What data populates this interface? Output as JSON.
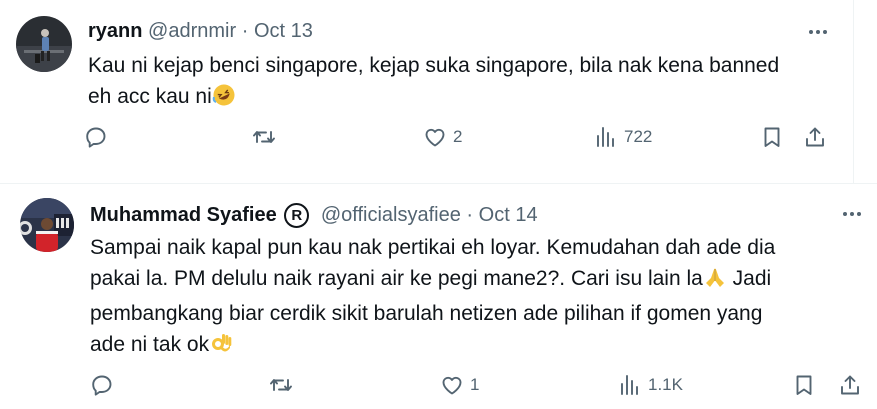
{
  "tweets": [
    {
      "display_name": "ryann",
      "handle": "@adrnmir",
      "separator": "·",
      "date": "Oct 13",
      "text_line1": "Kau ni kejap benci singapore, kejap suka singapore, bila nak kena banned",
      "text_line2": "eh acc kau ni",
      "emoji": "rolling-on-floor-laughing",
      "replies": "",
      "retweets": "",
      "likes": "2",
      "views": "722"
    },
    {
      "display_name": "Muhammad Syafiee",
      "badge": "R",
      "handle": "@officialsyafiee",
      "separator": "·",
      "date": "Oct 14",
      "text_line1": "Sampai naik kapal pun kau nak pertikai eh loyar. Kemudahan dah ade dia",
      "text_line2": "pakai la. PM delulu naik rayani air ke pegi mane2?. Cari isu lain la",
      "text_line3": " Jadi",
      "text_line4": "pembangkang biar cerdik sikit barulah netizen ade pilihan if gomen yang",
      "text_line5": "ade ni tak ok",
      "emoji_a": "folded-hands",
      "emoji_b": "ok-hand",
      "replies": "",
      "retweets": "",
      "likes": "1",
      "views": "1.1K"
    }
  ],
  "colors": {
    "text": "#0f1419",
    "muted": "#536471",
    "divider": "#eff3f4",
    "emoji": "#f5c33b"
  }
}
